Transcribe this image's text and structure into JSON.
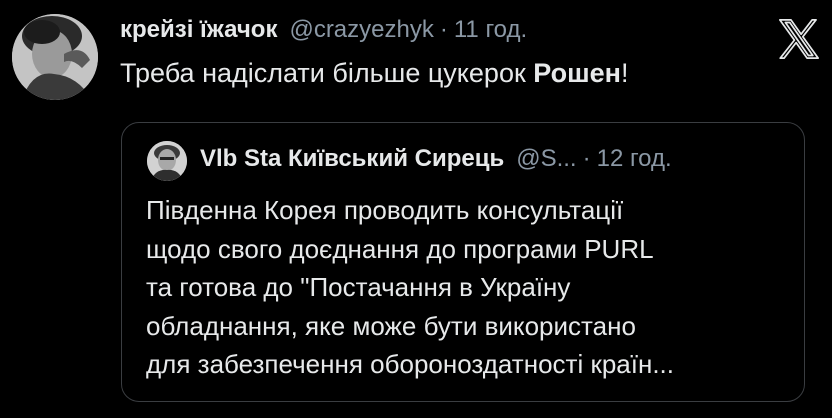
{
  "tweet": {
    "author": {
      "display_name": "крейзі їжачок",
      "handle": "@crazyezhyk",
      "separator": "·",
      "time": "11 год."
    },
    "text_prefix": "Треба надіслати більше цукерок ",
    "text_brand": "Рошен",
    "text_suffix": "!"
  },
  "quoted_tweet": {
    "author": {
      "display_name": "Vlb Sta Київський Сирець",
      "handle": "@S...",
      "separator": "·",
      "time": "12 год."
    },
    "lines": [
      "Південна Корея проводить консультації",
      "щодо свого доєднання до програми PURL",
      "та готова до \"Постачання в Україну",
      "обладнання, яке може бути використано",
      "для забезпечення обороноздатності країн..."
    ]
  },
  "icons": {
    "platform_logo": "x-logo-icon",
    "avatar": "avatar-icon",
    "quoted_avatar": "quoted-avatar-icon"
  },
  "colors": {
    "background": "#000000",
    "text_primary": "#e7e9ea",
    "text_secondary": "#8b98a5",
    "quote_border": "#3a3d41"
  }
}
